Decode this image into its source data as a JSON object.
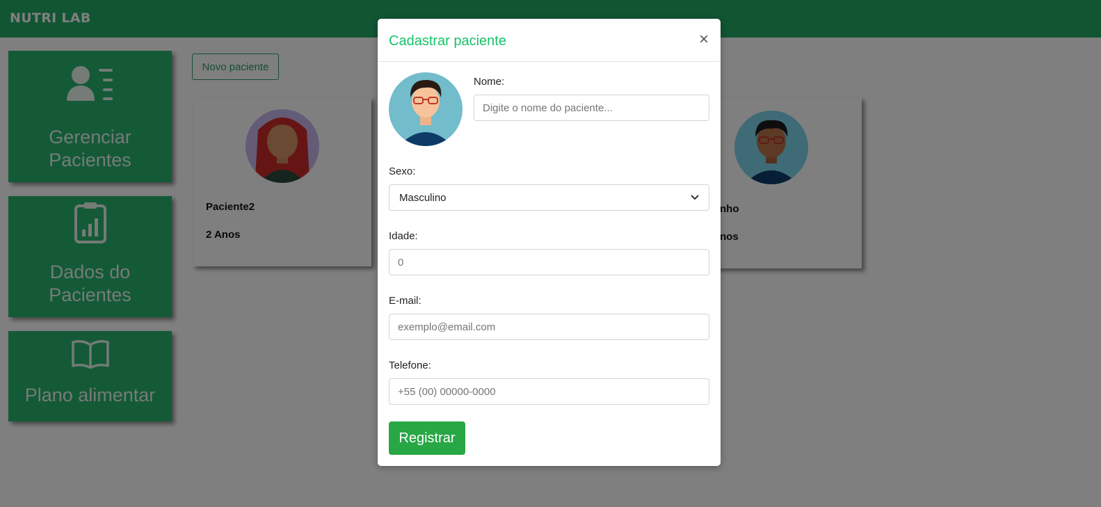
{
  "app": {
    "brand": "NUTRI LAB"
  },
  "sidebar": {
    "items": [
      {
        "label_line1": "Gerenciar",
        "label_line2": "Pacientes",
        "icon": "user-list-icon"
      },
      {
        "label_line1": "Dados do",
        "label_line2": "Pacientes",
        "icon": "clipboard-chart-icon"
      },
      {
        "label_line1": "Plano alimentar",
        "label_line2": "",
        "icon": "open-book-icon"
      }
    ]
  },
  "main": {
    "new_patient_label": "Novo paciente",
    "patients": [
      {
        "name": "Paciente2",
        "age": "2 Anos",
        "avatar": "female-avatar-icon"
      },
      {
        "name": "nho",
        "age": "nos",
        "avatar": "male-avatar-icon"
      }
    ]
  },
  "modal": {
    "title": "Cadastrar paciente",
    "close_symbol": "×",
    "fields": {
      "nome": {
        "label": "Nome:",
        "placeholder": "Digite o nome do paciente..."
      },
      "sexo": {
        "label": "Sexo:",
        "value": "Masculino"
      },
      "idade": {
        "label": "Idade:",
        "placeholder": "0"
      },
      "email": {
        "label": "E-mail:",
        "placeholder": "exemplo@email.com"
      },
      "telefone": {
        "label": "Telefone:",
        "placeholder": "+55 (00) 00000-0000"
      }
    },
    "submit_label": "Registrar"
  },
  "colors": {
    "navbar": "#22aa66",
    "menu_card": "#29b46e",
    "title_green": "#15c46a",
    "register_button": "#28a745"
  }
}
